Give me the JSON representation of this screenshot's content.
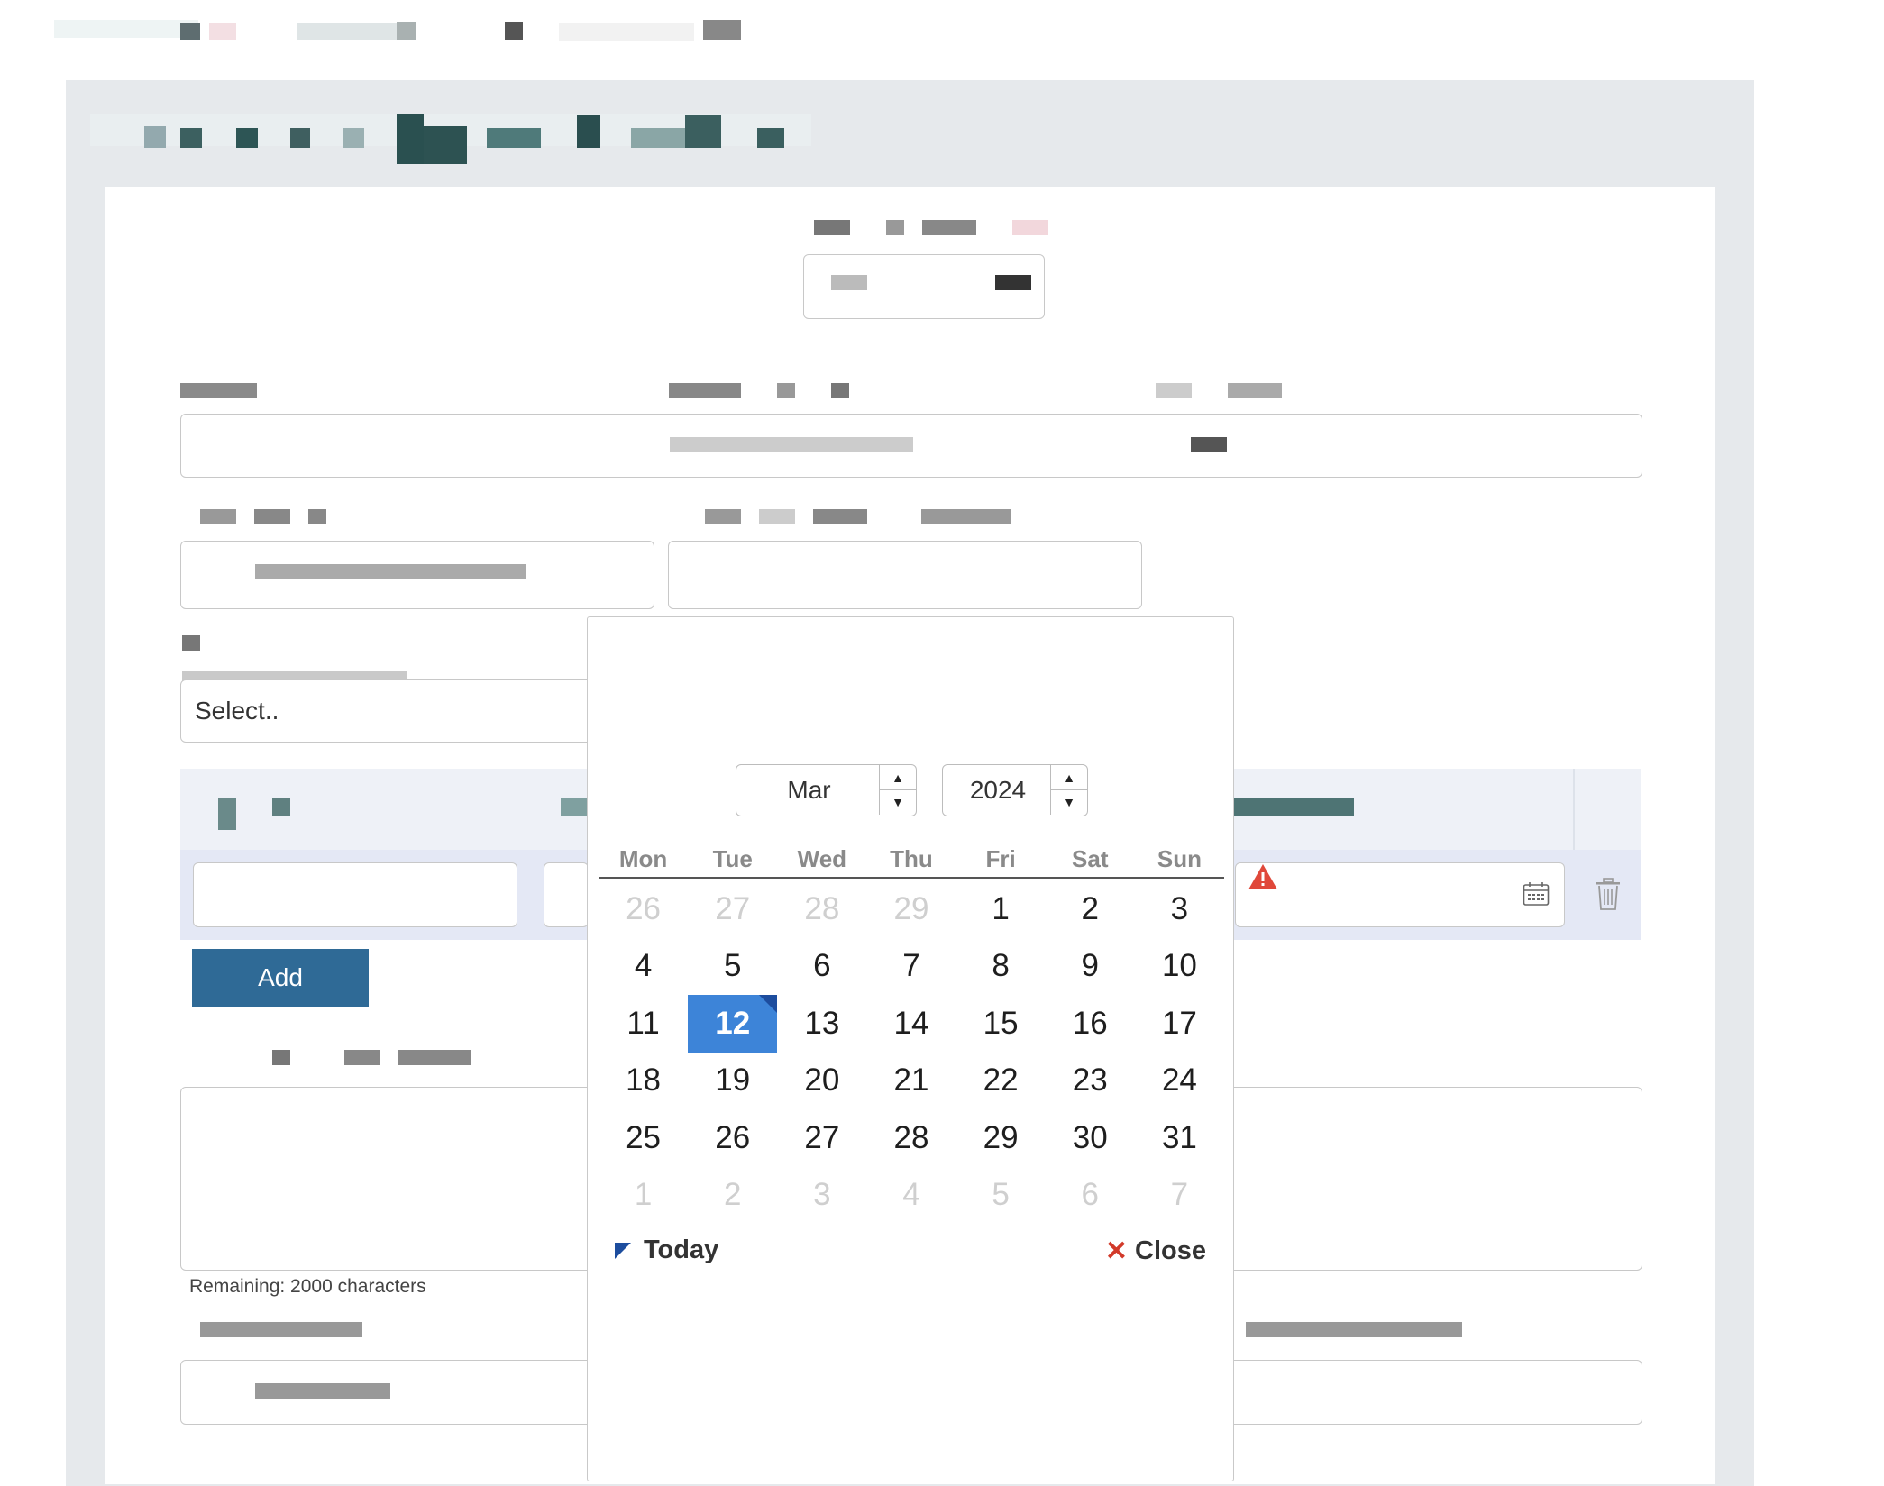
{
  "form": {
    "select_placeholder": "Select..",
    "add_label": "Add",
    "remaining_text": "Remaining: 2000 characters"
  },
  "datepicker": {
    "month": "Mar",
    "year": "2024",
    "weekdays": [
      "Mon",
      "Tue",
      "Wed",
      "Thu",
      "Fri",
      "Sat",
      "Sun"
    ],
    "weeks": [
      [
        "26",
        "27",
        "28",
        "29",
        "1",
        "2",
        "3"
      ],
      [
        "4",
        "5",
        "6",
        "7",
        "8",
        "9",
        "10"
      ],
      [
        "11",
        "12",
        "13",
        "14",
        "15",
        "16",
        "17"
      ],
      [
        "18",
        "19",
        "20",
        "21",
        "22",
        "23",
        "24"
      ],
      [
        "25",
        "26",
        "27",
        "28",
        "29",
        "30",
        "31"
      ],
      [
        "1",
        "2",
        "3",
        "4",
        "5",
        "6",
        "7"
      ]
    ],
    "muted_first_week": [
      0,
      1,
      2,
      3
    ],
    "selected_day": "12",
    "today_label": "Today",
    "close_label": "Close"
  },
  "colors": {
    "accent": "#2f6a96",
    "selected": "#3d84d8",
    "warning": "#e0483a"
  }
}
